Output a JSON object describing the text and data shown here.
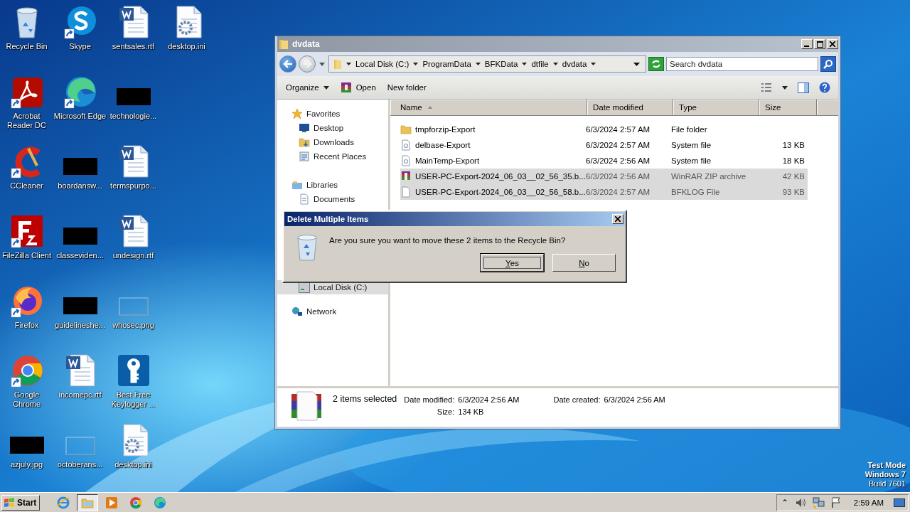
{
  "desktop": {
    "icons": [
      {
        "label": "Recycle Bin",
        "kind": "recycle",
        "shortcut": false
      },
      {
        "label": "Acrobat Reader DC",
        "kind": "acrobat",
        "shortcut": true
      },
      {
        "label": "CCleaner",
        "kind": "ccleaner",
        "shortcut": true
      },
      {
        "label": "FileZilla Client",
        "kind": "filezilla",
        "shortcut": true
      },
      {
        "label": "Firefox",
        "kind": "firefox",
        "shortcut": true
      },
      {
        "label": "Google Chrome",
        "kind": "chrome",
        "shortcut": true
      },
      {
        "label": "azjuly.jpg",
        "kind": "redacted",
        "shortcut": false
      },
      {
        "label": "Skype",
        "kind": "skype",
        "shortcut": true
      },
      {
        "label": "Microsoft Edge",
        "kind": "edge",
        "shortcut": true
      },
      {
        "label": "boardansw...",
        "kind": "redacted",
        "shortcut": false
      },
      {
        "label": "classeviden...",
        "kind": "redacted",
        "shortcut": false
      },
      {
        "label": "guidelineshe...",
        "kind": "redacted",
        "shortcut": false
      },
      {
        "label": "incomepc.rtf",
        "kind": "word",
        "shortcut": false
      },
      {
        "label": "octoberans...",
        "kind": "blank",
        "shortcut": false
      },
      {
        "label": "sentsales.rtf",
        "kind": "word",
        "shortcut": false
      },
      {
        "label": "technologie...",
        "kind": "redacted",
        "shortcut": false
      },
      {
        "label": "termspurpo...",
        "kind": "word",
        "shortcut": false
      },
      {
        "label": "undesign.rtf",
        "kind": "word",
        "shortcut": false
      },
      {
        "label": "whosec.png",
        "kind": "blank",
        "shortcut": false
      },
      {
        "label": "Best Free Keylogger ...",
        "kind": "keylogger",
        "shortcut": false
      },
      {
        "label": "desktop.ini",
        "kind": "ini",
        "shortcut": false
      },
      {
        "label": "desktop.ini",
        "kind": "ini",
        "shortcut": false
      }
    ],
    "notice": [
      "Test Mode",
      "Windows 7",
      "Build 7601"
    ]
  },
  "window": {
    "title": "dvdata",
    "breadcrumb": [
      "Local Disk (C:)",
      "ProgramData",
      "BFKData",
      "dtfile",
      "dvdata"
    ],
    "search": {
      "placeholder": "Search dvdata"
    },
    "toolbar": [
      {
        "label": "Organize",
        "kind": "menu"
      },
      {
        "label": "Open",
        "kind": "open"
      },
      {
        "label": "New folder",
        "kind": "plain"
      }
    ],
    "nav": [
      {
        "label": "Favorites",
        "kind": "star",
        "selected": false,
        "children": [
          {
            "label": "Desktop",
            "kind": "desktop",
            "selected": false
          },
          {
            "label": "Downloads",
            "kind": "downloads",
            "selected": false
          },
          {
            "label": "Recent Places",
            "kind": "recent",
            "selected": false
          }
        ]
      },
      {
        "label": "Libraries",
        "kind": "libraries",
        "selected": false,
        "children": [
          {
            "label": "Documents",
            "kind": "documents",
            "selected": false
          }
        ]
      },
      {
        "label": "Local Disk (C:)",
        "kind": "disk",
        "selected": true
      },
      {
        "label": "Network",
        "kind": "network",
        "selected": false
      }
    ],
    "columns": [
      "Name",
      "Date modified",
      "Type",
      "Size"
    ],
    "files": [
      {
        "name": "tmpforzip-Export",
        "date": "6/3/2024 2:57 AM",
        "type": "File folder",
        "kind": "folder",
        "selected": false
      },
      {
        "name": "delbase-Export",
        "date": "6/3/2024 2:57 AM",
        "type": "System file",
        "size": "13 KB",
        "kind": "sysfile",
        "selected": false
      },
      {
        "name": "MainTemp-Export",
        "date": "6/3/2024 2:56 AM",
        "type": "System file",
        "size": "18 KB",
        "kind": "sysfile",
        "selected": false
      },
      {
        "name": "USER-PC-Export-2024_06_03__02_56_35.b...",
        "date": "6/3/2024 2:56 AM",
        "type": "WinRAR ZIP archive",
        "size": "42 KB",
        "kind": "archive",
        "selected": true
      },
      {
        "name": "USER-PC-Export-2024_06_03__02_56_58.b...",
        "date": "6/3/2024 2:57 AM",
        "type": "BFKLOG File",
        "size": "93 KB",
        "kind": "blank",
        "selected": true
      }
    ],
    "details": {
      "summary": "2 items selected",
      "modified_label": "Date modified:",
      "modified": "6/3/2024 2:56 AM",
      "size_label": "Size:",
      "size": "134 KB",
      "created_label": "Date created:",
      "created": "6/3/2024 2:56 AM"
    }
  },
  "dialog": {
    "title": "Delete Multiple Items",
    "message": "Are you sure you want to move these 2 items to the Recycle Bin?",
    "buttons": [
      {
        "label": "Yes",
        "focused": true
      },
      {
        "label": "No",
        "focused": false
      }
    ]
  },
  "taskbar": {
    "start": "Start",
    "pinned": [
      {
        "kind": "ie",
        "active": false
      },
      {
        "kind": "explorer",
        "active": true
      },
      {
        "kind": "media",
        "active": false
      },
      {
        "kind": "chrome",
        "active": false
      },
      {
        "kind": "edge",
        "active": false
      }
    ],
    "tray_arrow": "⌃",
    "time": "2:59 AM"
  }
}
